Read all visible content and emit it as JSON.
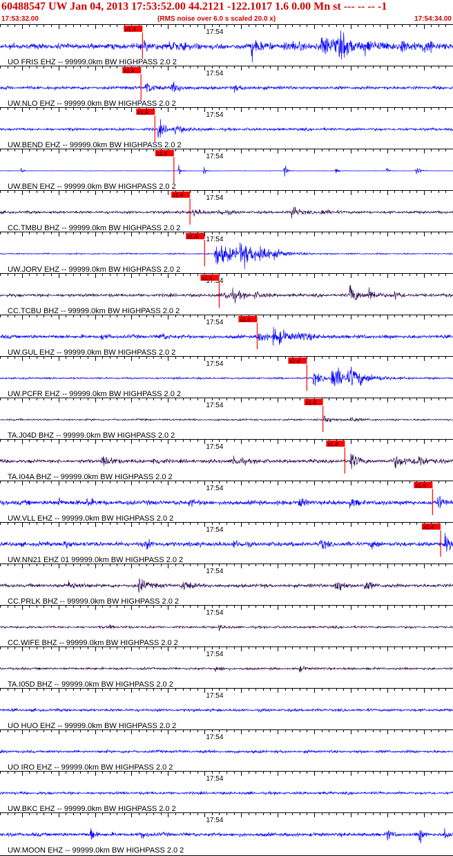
{
  "header": {
    "title": "60488547 UW Jan 04, 2013 17:53:52.00   44.2121 -122.1017  1.6 0.00 Mn st --- -- --   -1",
    "start_time": "17:53:32.00",
    "note": "(RMS noise over 6.0 s scaled 20.0 x)",
    "end_time": "17:54:34.00"
  },
  "chart_data": {
    "type": "line",
    "time_start": "17:53:32.00",
    "time_end": "17:54:34.00",
    "minute_mark_label": "17:54",
    "pick_label": "x1.4",
    "colors": {
      "blue": "#0000ff",
      "purple": "#2a0a50",
      "pick": "#ff0000",
      "tick": "#000000",
      "title": "#d00000"
    },
    "traces": [
      {
        "label": "UO FRIS EHZ -- 99999.0km BW  HIGHPASS  2.0  2",
        "color": "blue",
        "noise": 6,
        "pick_s": 19.5,
        "bursts": [
          [
            19.8,
            10,
            0.8
          ],
          [
            23,
            9,
            2
          ],
          [
            34.5,
            23,
            0.8
          ],
          [
            39,
            7,
            3
          ],
          [
            44,
            18,
            3
          ],
          [
            46.5,
            14,
            1.5
          ],
          [
            50,
            9,
            1
          ],
          [
            52,
            7,
            1
          ],
          [
            55,
            12,
            1.2
          ],
          [
            58,
            8,
            1
          ],
          [
            59,
            9,
            0.5
          ]
        ]
      },
      {
        "label": "UW.NLO EHZ -- 99999.0km BW  HIGHPASS  2.0  2",
        "color": "blue",
        "noise": 3.5,
        "pick_s": 19.3,
        "bursts": [
          [
            20,
            12,
            0.8
          ],
          [
            23.5,
            10,
            1.2
          ],
          [
            32,
            4,
            2
          ]
        ]
      },
      {
        "label": "UW.BEND EHZ -- 99999.0km BW  HIGHPASS  2.0  2",
        "color": "blue",
        "noise": 3,
        "pick_s": 21.2,
        "bursts": [
          [
            21.7,
            17,
            0.8
          ],
          [
            24,
            8,
            1.2
          ]
        ]
      },
      {
        "label": "UW.BEN EHZ -- 99999.0km BW  HIGHPASS  2.0  2",
        "color": "blue",
        "noise": 0.5,
        "pick_s": 23.8,
        "bursts": [
          [
            3,
            6,
            0.2
          ],
          [
            24.5,
            10,
            0.3
          ],
          [
            28,
            9,
            0.3
          ],
          [
            39,
            13,
            0.3
          ],
          [
            46,
            5,
            0.3
          ],
          [
            53,
            8,
            0.3
          ],
          [
            57,
            13,
            0.4
          ],
          [
            63,
            9,
            0.3
          ]
        ]
      },
      {
        "label": "CC.TMBU BHZ -- 99999.0km BW  HIGHPASS  2.0  2",
        "color": "purple",
        "noise": 3,
        "pick_s": 26,
        "bursts": [
          [
            26.5,
            8,
            1
          ],
          [
            30,
            6,
            1
          ],
          [
            40,
            14,
            0.8
          ],
          [
            44,
            6,
            1
          ]
        ]
      },
      {
        "label": "UW.JORV EHZ -- 99999.0km BW  HIGHPASS  2.0  2",
        "color": "blue",
        "noise": 1.5,
        "pick_s": 28,
        "bursts": [
          [
            29.5,
            24,
            3
          ],
          [
            33,
            18,
            2.5
          ],
          [
            35.5,
            14,
            1.5
          ]
        ]
      },
      {
        "label": "CC.TCBU BHZ -- 99999.0km BW  HIGHPASS  2.0  2",
        "color": "purple",
        "noise": 3.5,
        "pick_s": 30,
        "bursts": [
          [
            30.8,
            14,
            0.8
          ],
          [
            32,
            8,
            1
          ],
          [
            35,
            6,
            1
          ],
          [
            48,
            20,
            1
          ],
          [
            50.5,
            12,
            1
          ],
          [
            54,
            8,
            0.8
          ]
        ]
      },
      {
        "label": "UW.GUL EHZ -- 99999.0km BW  HIGHPASS  2.0  2",
        "color": "blue",
        "noise": 4,
        "pick_s": 35.2,
        "bursts": [
          [
            35.5,
            12,
            0.8
          ],
          [
            37.5,
            20,
            1.5
          ],
          [
            41,
            8,
            1.2
          ],
          [
            22,
            7,
            0.8
          ],
          [
            14,
            6,
            0.5
          ]
        ]
      },
      {
        "label": "UW.PCFR EHZ -- 99999.0km BW  HIGHPASS  2.0  2",
        "color": "blue",
        "noise": 2,
        "pick_s": 42,
        "bursts": [
          [
            43,
            14,
            1
          ],
          [
            45.5,
            25,
            2.5
          ],
          [
            48,
            12,
            2
          ]
        ]
      },
      {
        "label": "TA.J04D BHZ -- 99999.0km BW  HIGHPASS  2.0  2",
        "color": "purple",
        "noise": 2,
        "pick_s": 44.2,
        "bursts": [
          [
            44.5,
            10,
            0.8
          ],
          [
            48,
            6,
            1
          ]
        ]
      },
      {
        "label": "TA.I04A BHZ -- 99999.0km BW  HIGHPASS  2.0  2",
        "color": "purple",
        "noise": 4,
        "pick_s": 47.2,
        "bursts": [
          [
            14,
            9,
            1.5
          ],
          [
            21,
            7,
            1
          ],
          [
            32,
            8,
            1.5
          ],
          [
            48,
            20,
            0.8
          ],
          [
            54,
            10,
            2.5
          ],
          [
            57,
            13,
            1
          ]
        ]
      },
      {
        "label": "UW.VLL EHZ -- 99999.0km BW  HIGHPASS  2.0  2",
        "color": "blue",
        "noise": 5,
        "pick_s": 59.2,
        "bursts": [
          [
            8,
            10,
            0.5
          ],
          [
            12,
            12,
            0.5
          ],
          [
            26,
            9,
            0.5
          ],
          [
            41,
            10,
            0.5
          ],
          [
            48,
            9,
            0.5
          ],
          [
            60,
            14,
            0.8
          ]
        ]
      },
      {
        "label": "UW.NN21 EHZ 01 99999.0km BW  HIGHPASS  2.0  2",
        "color": "blue",
        "noise": 5,
        "pick_s": 60.3,
        "bursts": [
          [
            9,
            8,
            0.6
          ],
          [
            20,
            9,
            0.6
          ],
          [
            32,
            8,
            0.6
          ],
          [
            44,
            9,
            0.6
          ],
          [
            51,
            8,
            0.6
          ],
          [
            61,
            16,
            0.8
          ]
        ]
      },
      {
        "label": "CC.PRLK BHZ -- 99999.0km BW  HIGHPASS  2.0  2",
        "color": "purple",
        "noise": 4,
        "pick_s": null,
        "bursts": [
          [
            9.5,
            10,
            1
          ],
          [
            19,
            14,
            1
          ],
          [
            25,
            9,
            1
          ],
          [
            46,
            16,
            0.8
          ],
          [
            50,
            8,
            1
          ]
        ]
      },
      {
        "label": "CC.WIFE BHZ -- 99999.0km BW  HIGHPASS  2.0  2",
        "color": "purple",
        "noise": 2.5,
        "pick_s": null,
        "bursts": [
          [
            15,
            6,
            0.5
          ],
          [
            30,
            5,
            0.5
          ]
        ]
      },
      {
        "label": "TA.I05D BHZ -- 99999.0km BW  HIGHPASS  2.0  2",
        "color": "purple",
        "noise": 2.5,
        "pick_s": null,
        "bursts": [
          [
            29.5,
            6,
            0.8
          ],
          [
            41,
            5,
            0.8
          ]
        ]
      },
      {
        "label": "UO HUO EHZ -- 99999.0km BW  HIGHPASS  2.0  2",
        "color": "blue",
        "noise": 3,
        "pick_s": null,
        "bursts": []
      },
      {
        "label": "UO IRO EHZ -- 99999.0km BW  HIGHPASS  2.0  2",
        "color": "blue",
        "noise": 3,
        "pick_s": null,
        "bursts": [
          [
            65,
            10,
            0.3
          ]
        ]
      },
      {
        "label": "UW.BKC EHZ -- 99999.0km BW  HIGHPASS  2.0  2",
        "color": "blue",
        "noise": 3,
        "pick_s": null,
        "bursts": []
      },
      {
        "label": "UW.MOON EHZ -- 99999.0km BW  HIGHPASS  2.0  2",
        "color": "blue",
        "noise": 4,
        "pick_s": null,
        "bursts": [
          [
            12.5,
            14,
            0.4
          ],
          [
            19.5,
            10,
            0.4
          ],
          [
            53,
            12,
            0.4
          ],
          [
            57.5,
            14,
            0.4
          ],
          [
            61,
            10,
            0.4
          ]
        ]
      }
    ]
  }
}
